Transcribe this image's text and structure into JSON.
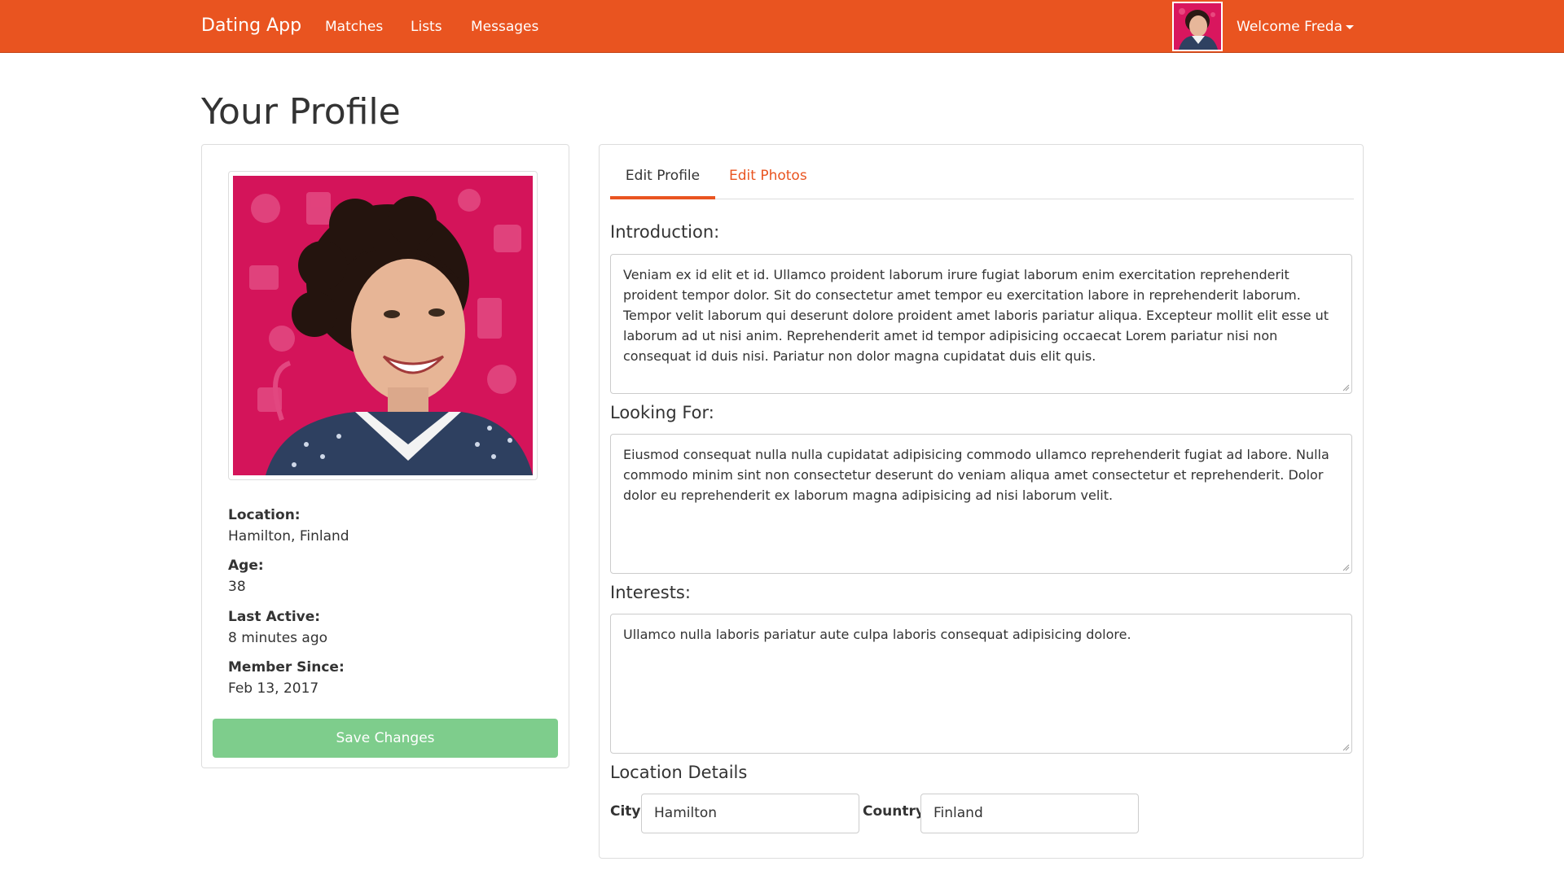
{
  "navbar": {
    "brand": "Dating App",
    "links": [
      "Matches",
      "Lists",
      "Messages"
    ],
    "welcome": "Welcome Freda",
    "accent_color": "#E95420"
  },
  "page_title": "Your Profile",
  "profile_card": {
    "photo_icon": "profile-photo",
    "location_label": "Location:",
    "location_value": "Hamilton, Finland",
    "age_label": "Age:",
    "age_value": "38",
    "last_active_label": "Last Active:",
    "last_active_value": "8 minutes ago",
    "member_since_label": "Member Since:",
    "member_since_value": "Feb 13, 2017",
    "save_button": "Save Changes",
    "save_button_color": "#7ecd8c"
  },
  "tabs": [
    "Edit Profile",
    "Edit Photos"
  ],
  "form": {
    "introduction_label": "Introduction:",
    "introduction_value": "Veniam ex id elit et id. Ullamco proident laborum irure fugiat laborum enim exercitation reprehenderit proident tempor dolor. Sit do consectetur amet tempor eu exercitation labore in reprehenderit laborum. Tempor velit laborum qui deserunt dolore proident amet laboris pariatur aliqua. Excepteur mollit elit esse ut laborum ad ut nisi anim. Reprehenderit amet id tempor adipisicing occaecat Lorem pariatur nisi non consequat id duis nisi. Pariatur non dolor magna cupidatat duis elit quis.",
    "looking_for_label": "Looking For:",
    "looking_for_value": "Eiusmod consequat nulla nulla cupidatat adipisicing commodo ullamco reprehenderit fugiat ad labore. Nulla commodo minim sint non consectetur deserunt do veniam aliqua amet consectetur et reprehenderit. Dolor dolor eu reprehenderit ex laborum magna adipisicing ad nisi laborum velit.",
    "interests_label": "Interests:",
    "interests_value": "Ullamco nulla laboris pariatur aute culpa laboris consequat adipisicing dolore.",
    "location_details_label": "Location Details",
    "city_label": "City",
    "city_value": "Hamilton",
    "country_label": "Country",
    "country_value": "Finland"
  }
}
